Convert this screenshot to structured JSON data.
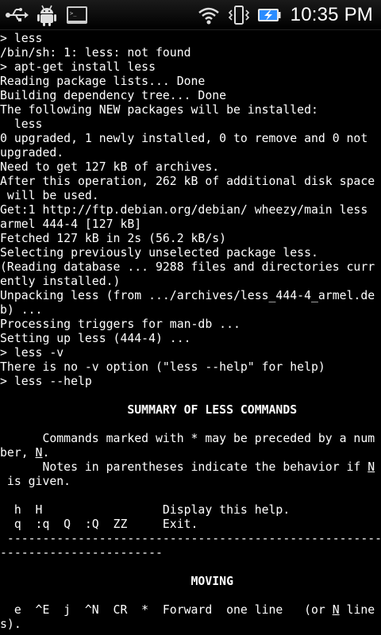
{
  "status_bar": {
    "left_icons": [
      "usb-icon",
      "android-debug-icon",
      "terminal-icon"
    ],
    "right_icons": [
      "wifi-icon",
      "vibrate-icon",
      "battery-charging-icon"
    ],
    "time": "10:35 PM"
  },
  "terminal": {
    "lines": [
      "> less",
      "/bin/sh: 1: less: not found",
      "> apt-get install less",
      "Reading package lists... Done",
      "Building dependency tree... Done",
      "The following NEW packages will be installed:",
      "  less",
      "0 upgraded, 1 newly installed, 0 to remove and 0 not",
      "upgraded.",
      "Need to get 127 kB of archives.",
      "After this operation, 262 kB of additional disk space",
      " will be used.",
      "Get:1 http://ftp.debian.org/debian/ wheezy/main less",
      "armel 444-4 [127 kB]",
      "Fetched 127 kB in 2s (56.2 kB/s)",
      "Selecting previously unselected package less.",
      "(Reading database ... 9288 files and directories curr",
      "ently installed.)",
      "Unpacking less (from .../archives/less_444-4_armel.de",
      "b) ...",
      "Processing triggers for man-db ...",
      "Setting up less (444-4) ...",
      "> less -v",
      "There is no -v option (\"less --help\" for help)",
      "> less --help",
      "",
      "                  SUMMARY OF LESS COMMANDS",
      "",
      "      Commands marked with * may be preceded by a num",
      "ber, N.",
      "      Notes in parentheses indicate the behavior if N",
      " is given.",
      "",
      "  h  H                 Display this help.",
      "  q  :q  Q  :Q  ZZ     Exit.",
      " -----------------------------------------------------",
      "-----------------------",
      "",
      "                           MOVING",
      "",
      "  e  ^E  j  ^N  CR  *  Forward  one line   (or N line",
      "s)."
    ]
  },
  "colors": {
    "background": "#000000",
    "text": "#ffffff",
    "battery_accent": "#2a8cff"
  }
}
